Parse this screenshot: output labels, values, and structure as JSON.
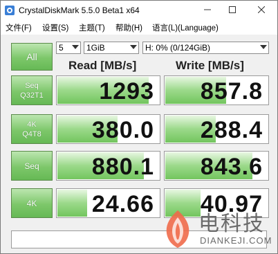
{
  "window": {
    "title": "CrystalDiskMark 5.5.0 Beta1 x64",
    "minimize_icon": "minimize-icon",
    "maximize_icon": "maximize-icon",
    "close_icon": "close-icon"
  },
  "menu": {
    "file": "文件(F)",
    "settings": "设置(S)",
    "theme": "主题(T)",
    "help": "帮助(H)",
    "language": "语言(L)(Language)"
  },
  "controls": {
    "all_label": "All",
    "count": "5",
    "size": "1GiB",
    "drive": "H: 0% (0/124GiB)"
  },
  "headers": {
    "read": "Read [MB/s]",
    "write": "Write [MB/s]"
  },
  "rows": [
    {
      "label_1": "Seq",
      "label_2": "Q32T1",
      "read": "1293",
      "write": "857.8",
      "read_fill": 0.9,
      "write_fill": 0.6
    },
    {
      "label_1": "4K",
      "label_2": "Q4T8",
      "read": "380.0",
      "write": "288.4",
      "read_fill": 0.6,
      "write_fill": 0.5
    },
    {
      "label_1": "Seq",
      "label_2": "",
      "read": "880.1",
      "write": "843.6",
      "read_fill": 0.85,
      "write_fill": 0.85
    },
    {
      "label_1": "4K",
      "label_2": "",
      "read": "24.66",
      "write": "40.97",
      "read_fill": 0.3,
      "write_fill": 0.35
    }
  ],
  "watermark": {
    "cn": "电科技",
    "en": "DIANKEJI.COM"
  },
  "colors": {
    "accent_green": "#7dc76a",
    "bar_green": "#9bd98a"
  }
}
